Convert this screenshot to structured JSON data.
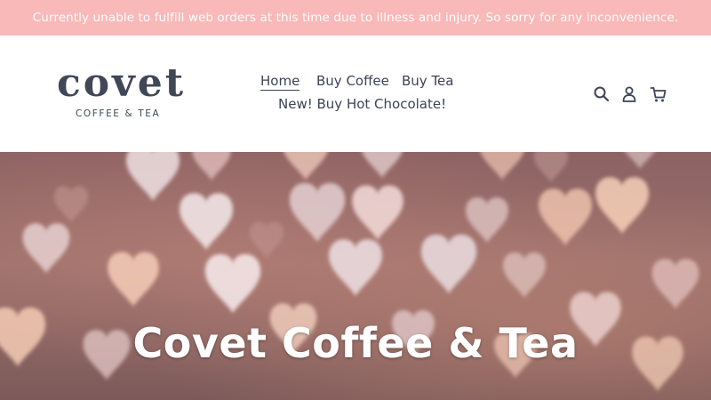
{
  "announcement": {
    "text": "Currently unable to fulfill web orders at this time due to illness and injury. So sorry for any inconvenience."
  },
  "logo": {
    "wordmark": "covet",
    "tagline": "COFFEE & TEA"
  },
  "nav": {
    "items": [
      {
        "label": "Home",
        "active": true
      },
      {
        "label": "Buy Coffee"
      },
      {
        "label": "Buy Tea"
      },
      {
        "label": "New! Buy Hot Chocolate!"
      }
    ]
  },
  "header_icons": [
    "search-icon",
    "account-icon",
    "cart-icon"
  ],
  "hero": {
    "title": "Covet Coffee & Tea",
    "background": "blurred-bokeh-hearts"
  },
  "colors": {
    "announcement_bg": "#f9b9b9",
    "brand_text": "#414757",
    "hero_overlay": "#8c6263",
    "heart_light": "#f1dcdc",
    "heart_peach": "#f6c8b4"
  }
}
